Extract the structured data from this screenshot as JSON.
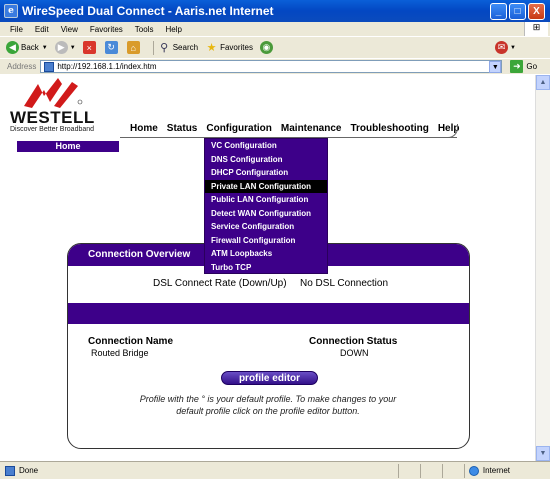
{
  "window": {
    "title": "WireSpeed Dual Connect - Aaris.net Internet",
    "minimize": "_",
    "maximize": "□",
    "close": "X"
  },
  "menu": [
    "File",
    "Edit",
    "View",
    "Favorites",
    "Tools",
    "Help"
  ],
  "toolbar": {
    "back": "Back",
    "search": "Search",
    "favorites": "Favorites"
  },
  "address": {
    "label": "Address",
    "url": "http://192.168.1.1/index.htm",
    "go": "Go"
  },
  "brand": {
    "name": "WESTELL",
    "tagline": "Discover Better Broadband"
  },
  "nav": [
    "Home",
    "Status",
    "Configuration",
    "Maintenance",
    "Troubleshooting",
    "Help"
  ],
  "home_bar": "Home",
  "dropdown": {
    "items": [
      "VC Configuration",
      "DNS Configuration",
      "DHCP Configuration",
      "Private LAN Configuration",
      "Public LAN Configuration",
      "Detect WAN Configuration",
      "Service Configuration",
      "Firewall Configuration",
      "ATM Loopbacks",
      "Turbo TCP"
    ],
    "active_index": 3
  },
  "panel": {
    "heading": "Connection Overview",
    "rate_label": "DSL Connect Rate (Down/Up)",
    "rate_value": "No DSL Connection",
    "col_name": "Connection Name",
    "col_status": "Connection Status",
    "row_name": "Routed Bridge",
    "row_status": "DOWN",
    "button": "profile editor",
    "note": "Profile with the ° is your default profile. To make changes to your default profile click on the profile editor button."
  },
  "status": {
    "text": "Done",
    "zone": "Internet"
  },
  "colors": {
    "accent": "#3d0089",
    "titlebar": "#0347c2"
  }
}
